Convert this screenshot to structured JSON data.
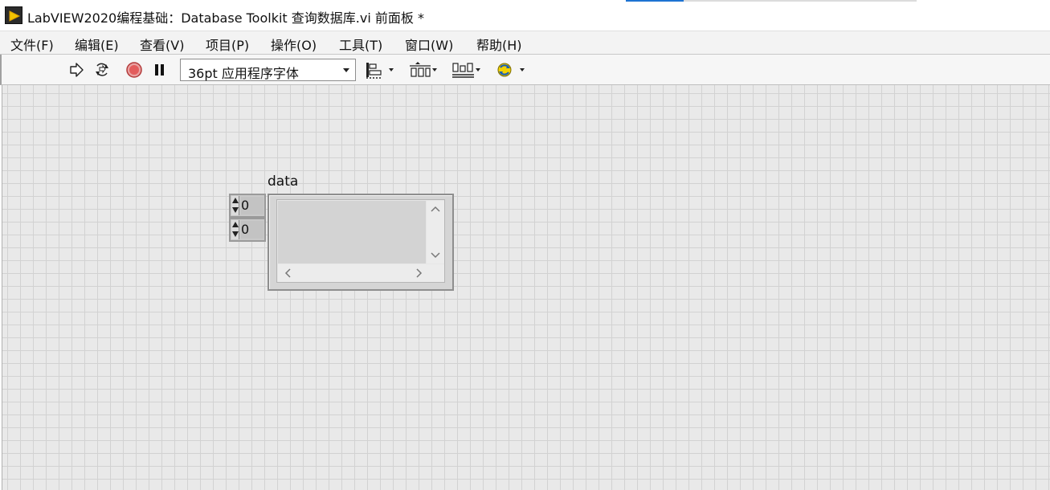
{
  "window": {
    "title": "LabVIEW2020编程基础：Database Toolkit 查询数据库.vi 前面板 *"
  },
  "menu": {
    "items": [
      "文件(F)",
      "编辑(E)",
      "查看(V)",
      "项目(P)",
      "操作(O)",
      "工具(T)",
      "窗口(W)",
      "帮助(H)"
    ]
  },
  "toolbar": {
    "font_select": "36pt 应用程序字体",
    "icons": [
      "run-arrow-icon",
      "run-continuously-icon",
      "abort-icon",
      "pause-icon",
      "align-objects-icon",
      "distribute-objects-icon",
      "resize-objects-icon",
      "reorder-icon"
    ]
  },
  "front_panel": {
    "array": {
      "label": "data",
      "indices": [
        "0",
        "0"
      ]
    }
  },
  "colors": {
    "panel_bg": "#e9e9e9",
    "grid": "#d2d2d2",
    "abort_red": "#e35c5c",
    "accent_blue": "#1e73d2"
  }
}
